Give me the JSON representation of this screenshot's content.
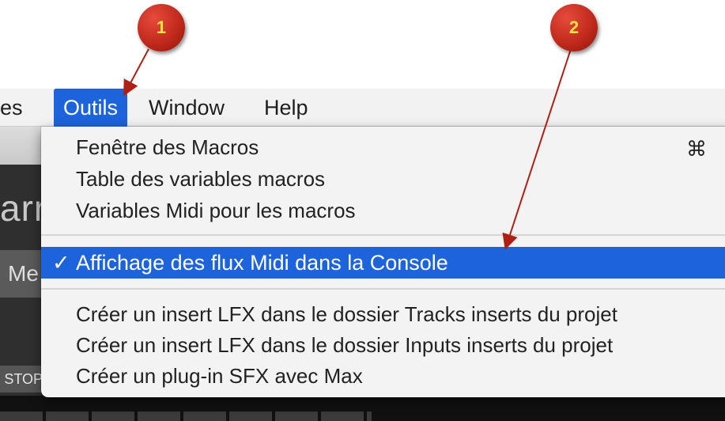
{
  "menubar": {
    "items": [
      {
        "label": "es",
        "active": false
      },
      {
        "label": "Outils",
        "active": true
      },
      {
        "label": "Window",
        "active": false
      },
      {
        "label": "Help",
        "active": false
      }
    ]
  },
  "dropdown": {
    "group1": [
      {
        "label": "Fenêtre des Macros",
        "shortcut": "⌘"
      },
      {
        "label": "Table des variables macros"
      },
      {
        "label": "Variables Midi pour les macros"
      }
    ],
    "checked_item": {
      "label": "Affichage des flux Midi dans la Console",
      "checkmark": "✓",
      "selected": true
    },
    "group3": [
      {
        "label": "Créer un insert LFX dans le dossier Tracks inserts du projet"
      },
      {
        "label": "Créer un insert LFX dans le dossier Inputs inserts du projet"
      },
      {
        "label": "Créer un plug-in SFX avec Max"
      }
    ]
  },
  "background_app": {
    "big_text": "arr",
    "button_text": "Me",
    "stop_label": "STOP"
  },
  "annotations": [
    {
      "number": "1"
    },
    {
      "number": "2"
    }
  ],
  "colors": {
    "selection": "#1d63dc",
    "callout": "#c12a1c",
    "callout_text": "#ffe342"
  }
}
